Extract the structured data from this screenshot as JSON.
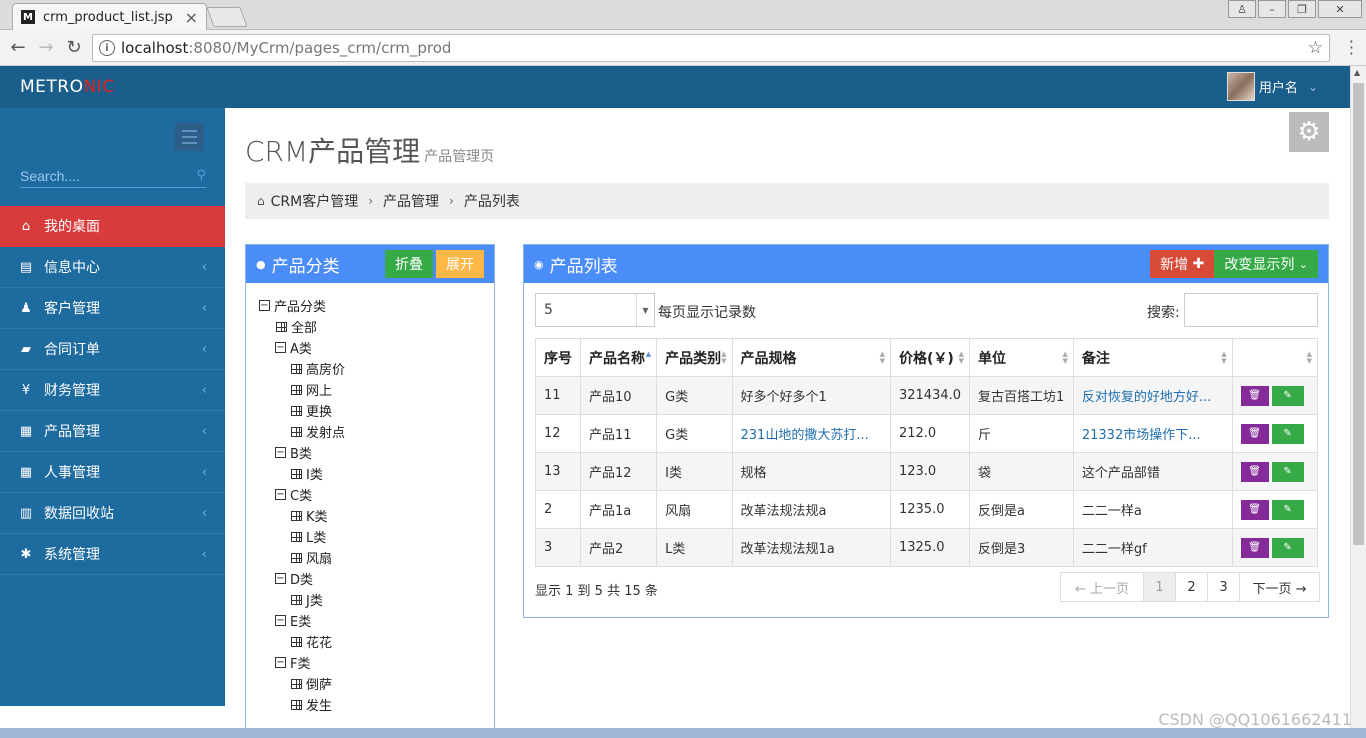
{
  "browser": {
    "tab_title": "crm_product_list.jsp",
    "tab_favicon": "M",
    "url_host": "localhost",
    "url_rest": ":8080/MyCrm/pages_crm/crm_prod"
  },
  "header": {
    "logo_main": "METRO",
    "logo_accent": "NIC",
    "username": "用户名"
  },
  "sidebar": {
    "search_placeholder": "Search....",
    "items": [
      {
        "label": "我的桌面",
        "icon": "home-icon",
        "glyph": "⌂"
      },
      {
        "label": "信息中心",
        "icon": "info-icon",
        "glyph": "▤"
      },
      {
        "label": "客户管理",
        "icon": "user-icon",
        "glyph": "♟"
      },
      {
        "label": "合同订单",
        "icon": "book-icon",
        "glyph": "▰"
      },
      {
        "label": "财务管理",
        "icon": "yen-icon",
        "glyph": "¥"
      },
      {
        "label": "产品管理",
        "icon": "table-icon",
        "glyph": "▦"
      },
      {
        "label": "人事管理",
        "icon": "table-icon",
        "glyph": "▦"
      },
      {
        "label": "数据回收站",
        "icon": "trash-icon",
        "glyph": "▥"
      },
      {
        "label": "系统管理",
        "icon": "gear-icon",
        "glyph": "✱"
      }
    ]
  },
  "page": {
    "title": "CRM产品管理",
    "subtitle": "产品管理页"
  },
  "breadcrumb": [
    "CRM客户管理",
    "产品管理",
    "产品列表"
  ],
  "category_panel": {
    "title": "产品分类",
    "collapse_label": "折叠",
    "expand_label": "展开",
    "tree": [
      {
        "label": "产品分类",
        "type": "folder",
        "level": 0
      },
      {
        "label": "全部",
        "type": "leaf",
        "level": 1
      },
      {
        "label": "A类",
        "type": "folder",
        "level": 1
      },
      {
        "label": "高房价",
        "type": "leaf",
        "level": 2
      },
      {
        "label": "网上",
        "type": "leaf",
        "level": 2
      },
      {
        "label": "更换",
        "type": "leaf",
        "level": 2
      },
      {
        "label": "发射点",
        "type": "leaf",
        "level": 2
      },
      {
        "label": "B类",
        "type": "folder",
        "level": 1
      },
      {
        "label": "I类",
        "type": "leaf",
        "level": 2
      },
      {
        "label": "C类",
        "type": "folder",
        "level": 1
      },
      {
        "label": "K类",
        "type": "leaf",
        "level": 2
      },
      {
        "label": "L类",
        "type": "leaf",
        "level": 2
      },
      {
        "label": "风扇",
        "type": "leaf",
        "level": 2
      },
      {
        "label": "D类",
        "type": "folder",
        "level": 1
      },
      {
        "label": "J类",
        "type": "leaf",
        "level": 2
      },
      {
        "label": "E类",
        "type": "folder",
        "level": 1
      },
      {
        "label": "花花",
        "type": "leaf",
        "level": 2
      },
      {
        "label": "F类",
        "type": "folder",
        "level": 1
      },
      {
        "label": "倒萨",
        "type": "leaf",
        "level": 2
      },
      {
        "label": "发生",
        "type": "leaf",
        "level": 2
      }
    ]
  },
  "product_panel": {
    "title": "产品列表",
    "add_label": "新增",
    "columns_label": "改变显示列",
    "page_size": "5",
    "per_page_label": "每页显示记录数",
    "search_label": "搜索:",
    "headers": [
      "序号",
      "产品名称",
      "产品类别",
      "产品规格",
      "价格(￥)",
      "单位",
      "备注",
      ""
    ],
    "rows": [
      [
        "11",
        "产品10",
        "G类",
        "好多个好多个1",
        "321434.0",
        "复古百搭工坊1",
        "反对恢复的好地方好..."
      ],
      [
        "12",
        "产品11",
        "G类",
        "231山地的撒大苏打...",
        "212.0",
        "斤",
        "21332市场操作下..."
      ],
      [
        "13",
        "产品12",
        "I类",
        "规格",
        "123.0",
        "袋",
        "这个产品部错"
      ],
      [
        "2",
        "产品1a",
        "风扇",
        "改革法规法规a",
        "1235.0",
        "反倒是a",
        "二二一样a"
      ],
      [
        "3",
        "产品2",
        "L类",
        "改革法规法规1a",
        "1325.0",
        "反倒是3",
        "二二一样gf"
      ]
    ],
    "link_cells": [
      [
        0,
        6
      ],
      [
        1,
        3
      ],
      [
        1,
        6
      ]
    ],
    "info": "显示 1 到 5 共 15 条",
    "pager": {
      "prev": "← 上一页",
      "pages": [
        "1",
        "2",
        "3"
      ],
      "next": "下一页 →"
    }
  },
  "watermark": "CSDN @QQ1061662411",
  "colors": {
    "header": "#1a5f8c",
    "sidebar": "#1e6ba0",
    "active": "#d83b3b",
    "panel_head": "#4b8df8"
  }
}
